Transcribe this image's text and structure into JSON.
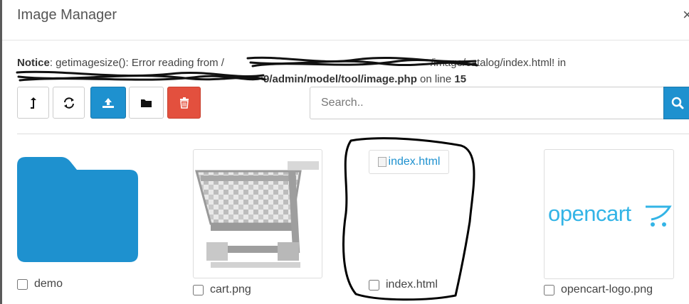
{
  "modal": {
    "title": "Image Manager",
    "close_icon": "×"
  },
  "notice": {
    "label": "Notice",
    "message": ": getimagesize(): Error reading from /",
    "path_end": "/image/catalog/index.html! in",
    "file_path": "9/admin/model/tool/image.php",
    "on_line": " on line ",
    "line_number": "15"
  },
  "toolbar": {
    "buttons": [
      {
        "icon": "level-up-icon",
        "style": "default"
      },
      {
        "icon": "refresh-icon",
        "style": "default"
      },
      {
        "icon": "upload-icon",
        "style": "primary"
      },
      {
        "icon": "folder-icon",
        "style": "default"
      },
      {
        "icon": "trash-icon",
        "style": "danger"
      }
    ],
    "search_placeholder": "Search..",
    "search_icon": "search-icon"
  },
  "items": [
    {
      "type": "folder",
      "name": "demo"
    },
    {
      "type": "image",
      "name": "cart.png"
    },
    {
      "type": "image-broken",
      "name": "index.html",
      "alt": "index.html"
    },
    {
      "type": "image",
      "name": "opencart-logo.png",
      "logo_text": "opencart"
    }
  ],
  "colors": {
    "primary": "#1e91cf",
    "danger": "#e3503e",
    "folder": "#1e91cf",
    "opencart_logo": "#33b4e6"
  }
}
